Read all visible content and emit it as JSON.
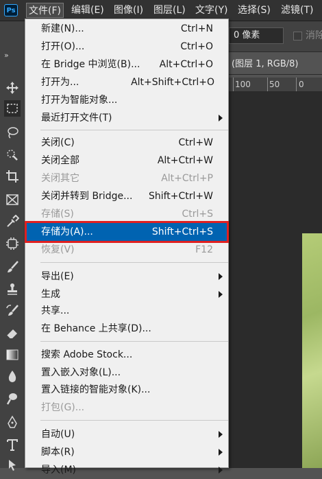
{
  "app": {
    "logo": "Ps"
  },
  "menubar": {
    "items": [
      {
        "label": "文件(F)"
      },
      {
        "label": "编辑(E)"
      },
      {
        "label": "图像(I)"
      },
      {
        "label": "图层(L)"
      },
      {
        "label": "文字(Y)"
      },
      {
        "label": "选择(S)"
      },
      {
        "label": "滤镜(T)"
      }
    ]
  },
  "options_bar": {
    "feather_value": "0 像素",
    "antialias_label": "消除"
  },
  "document": {
    "tab_title": "(图层 1, RGB/8)",
    "ruler_marks": [
      "100",
      "50",
      "0"
    ]
  },
  "toolbar": {
    "collapse": "»",
    "tools": [
      "move-icon",
      "marquee-icon",
      "lasso-icon",
      "quick-select-icon",
      "crop-icon",
      "frame-icon",
      "eyedropper-icon",
      "healing-icon",
      "brush-icon",
      "stamp-icon",
      "history-brush-icon",
      "eraser-icon",
      "gradient-icon",
      "blur-icon",
      "dodge-icon",
      "pen-icon",
      "type-icon",
      "path-select-icon"
    ]
  },
  "file_menu": {
    "groups": [
      [
        {
          "label": "新建(N)...",
          "shortcut": "Ctrl+N"
        },
        {
          "label": "打开(O)...",
          "shortcut": "Ctrl+O"
        },
        {
          "label": "在 Bridge 中浏览(B)...",
          "shortcut": "Alt+Ctrl+O"
        },
        {
          "label": "打开为...",
          "shortcut": "Alt+Shift+Ctrl+O"
        },
        {
          "label": "打开为智能对象...",
          "shortcut": ""
        },
        {
          "label": "最近打开文件(T)",
          "shortcut": "",
          "submenu": true
        }
      ],
      [
        {
          "label": "关闭(C)",
          "shortcut": "Ctrl+W"
        },
        {
          "label": "关闭全部",
          "shortcut": "Alt+Ctrl+W"
        },
        {
          "label": "关闭其它",
          "shortcut": "Alt+Ctrl+P",
          "disabled": true
        },
        {
          "label": "关闭并转到 Bridge...",
          "shortcut": "Shift+Ctrl+W"
        },
        {
          "label": "存储(S)",
          "shortcut": "Ctrl+S",
          "disabled": true
        },
        {
          "label": "存储为(A)...",
          "shortcut": "Shift+Ctrl+S",
          "highlighted": true
        },
        {
          "label": "恢复(V)",
          "shortcut": "F12",
          "disabled": true
        }
      ],
      [
        {
          "label": "导出(E)",
          "shortcut": "",
          "submenu": true
        },
        {
          "label": "生成",
          "shortcut": "",
          "submenu": true
        },
        {
          "label": "共享...",
          "shortcut": ""
        },
        {
          "label": "在 Behance 上共享(D)...",
          "shortcut": ""
        }
      ],
      [
        {
          "label": "搜索 Adobe Stock...",
          "shortcut": ""
        },
        {
          "label": "置入嵌入对象(L)...",
          "shortcut": ""
        },
        {
          "label": "置入链接的智能对象(K)...",
          "shortcut": ""
        },
        {
          "label": "打包(G)...",
          "shortcut": "",
          "disabled": true
        }
      ],
      [
        {
          "label": "自动(U)",
          "shortcut": "",
          "submenu": true
        },
        {
          "label": "脚本(R)",
          "shortcut": "",
          "submenu": true
        },
        {
          "label": "导入(M)",
          "shortcut": "",
          "submenu": true
        }
      ]
    ]
  },
  "colors": {
    "highlight": "#0063b1",
    "highlight_outline": "#e02020",
    "menu_bg": "#f0f0f0",
    "app_bg": "#323232"
  }
}
